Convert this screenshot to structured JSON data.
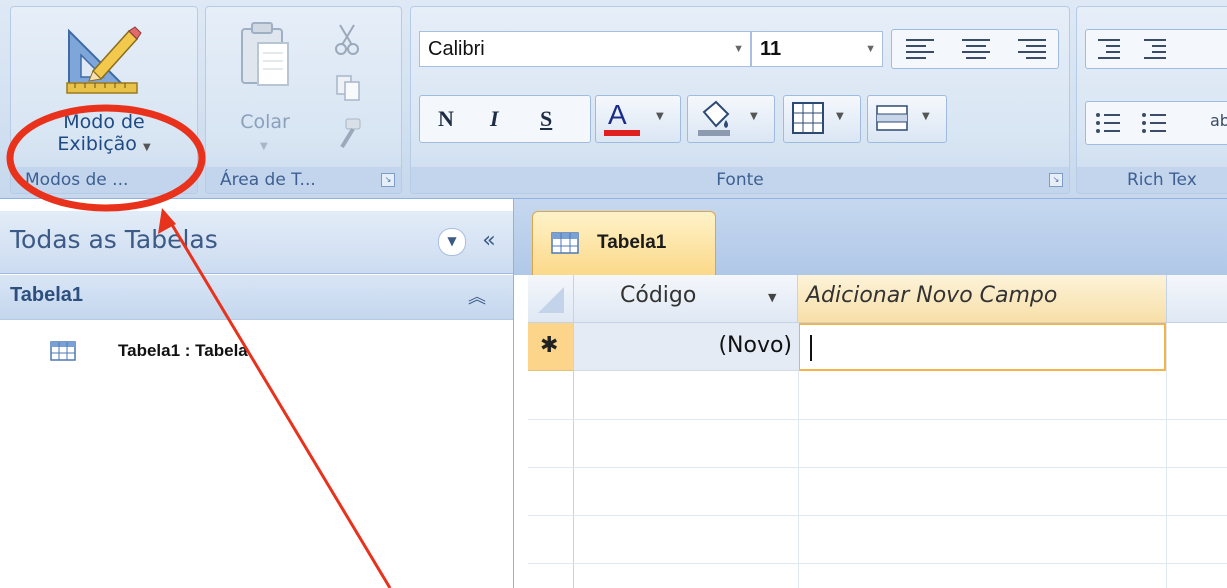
{
  "ribbon": {
    "views_group": {
      "button_line1": "Modo de",
      "button_line2": "Exibição",
      "label": "Modos de ..."
    },
    "clipboard_group": {
      "paste_label": "Colar",
      "label": "Área de T..."
    },
    "font_group": {
      "font_name": "Calibri",
      "font_size": "11",
      "bold": "N",
      "italic": "I",
      "underline": "S",
      "font_color_letter": "A",
      "label": "Fonte"
    },
    "rich_text_group": {
      "label": "Rich Tex",
      "ab_label": "ab"
    }
  },
  "nav_pane": {
    "title": "Todas as Tabelas",
    "collapse_glyph": "«",
    "group_name": "Tabela1",
    "items": [
      {
        "label": "Tabela1 : Tabela"
      }
    ]
  },
  "document": {
    "tab_label": "Tabela1",
    "columns": [
      "Código",
      "Adicionar Novo Campo"
    ],
    "new_row": {
      "marker": "✱",
      "value": "(Novo)"
    }
  },
  "colors": {
    "annotation_red": "#e8321c",
    "accent_orange": "#f5a623",
    "ribbon_blue": "#d3e1f1"
  }
}
